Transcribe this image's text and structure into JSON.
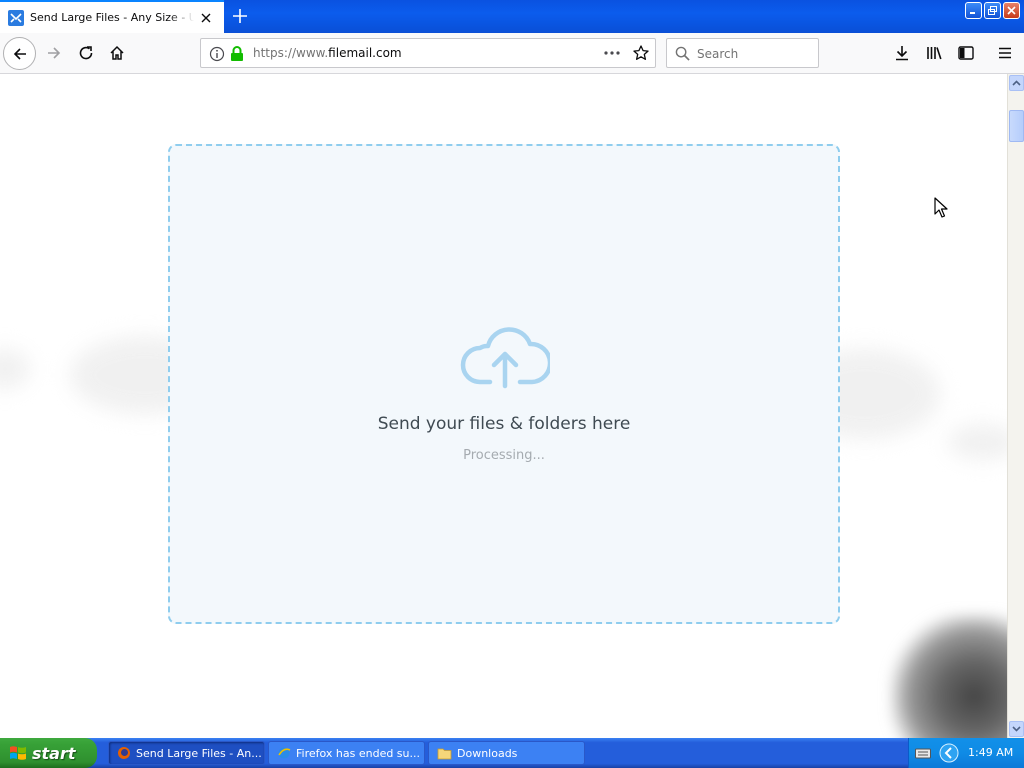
{
  "browser": {
    "tab": {
      "title": "Send Large Files - Any Size - Up To",
      "favicon": "filemail-icon"
    },
    "url": {
      "prefix": "https://www.",
      "domain": "filemail.com"
    },
    "search_placeholder": "Search"
  },
  "page": {
    "dropzone_headline": "Send your files & folders here",
    "dropzone_status": "Processing..."
  },
  "taskbar": {
    "start_label": "start",
    "items": [
      {
        "label": "Send Large Files - An...",
        "icon": "firefox-icon"
      },
      {
        "label": "Firefox has ended su...",
        "icon": "ie-icon"
      },
      {
        "label": "Downloads",
        "icon": "folder-icon"
      }
    ],
    "clock": "1:49 AM"
  },
  "colors": {
    "accent": "#0a84ff",
    "dropzone_border": "#8fcdee",
    "dropzone_bg": "#f3f8fc",
    "upload_icon": "#a9d4f0",
    "xp_taskbar": "#245edb",
    "xp_start": "#37a137"
  }
}
